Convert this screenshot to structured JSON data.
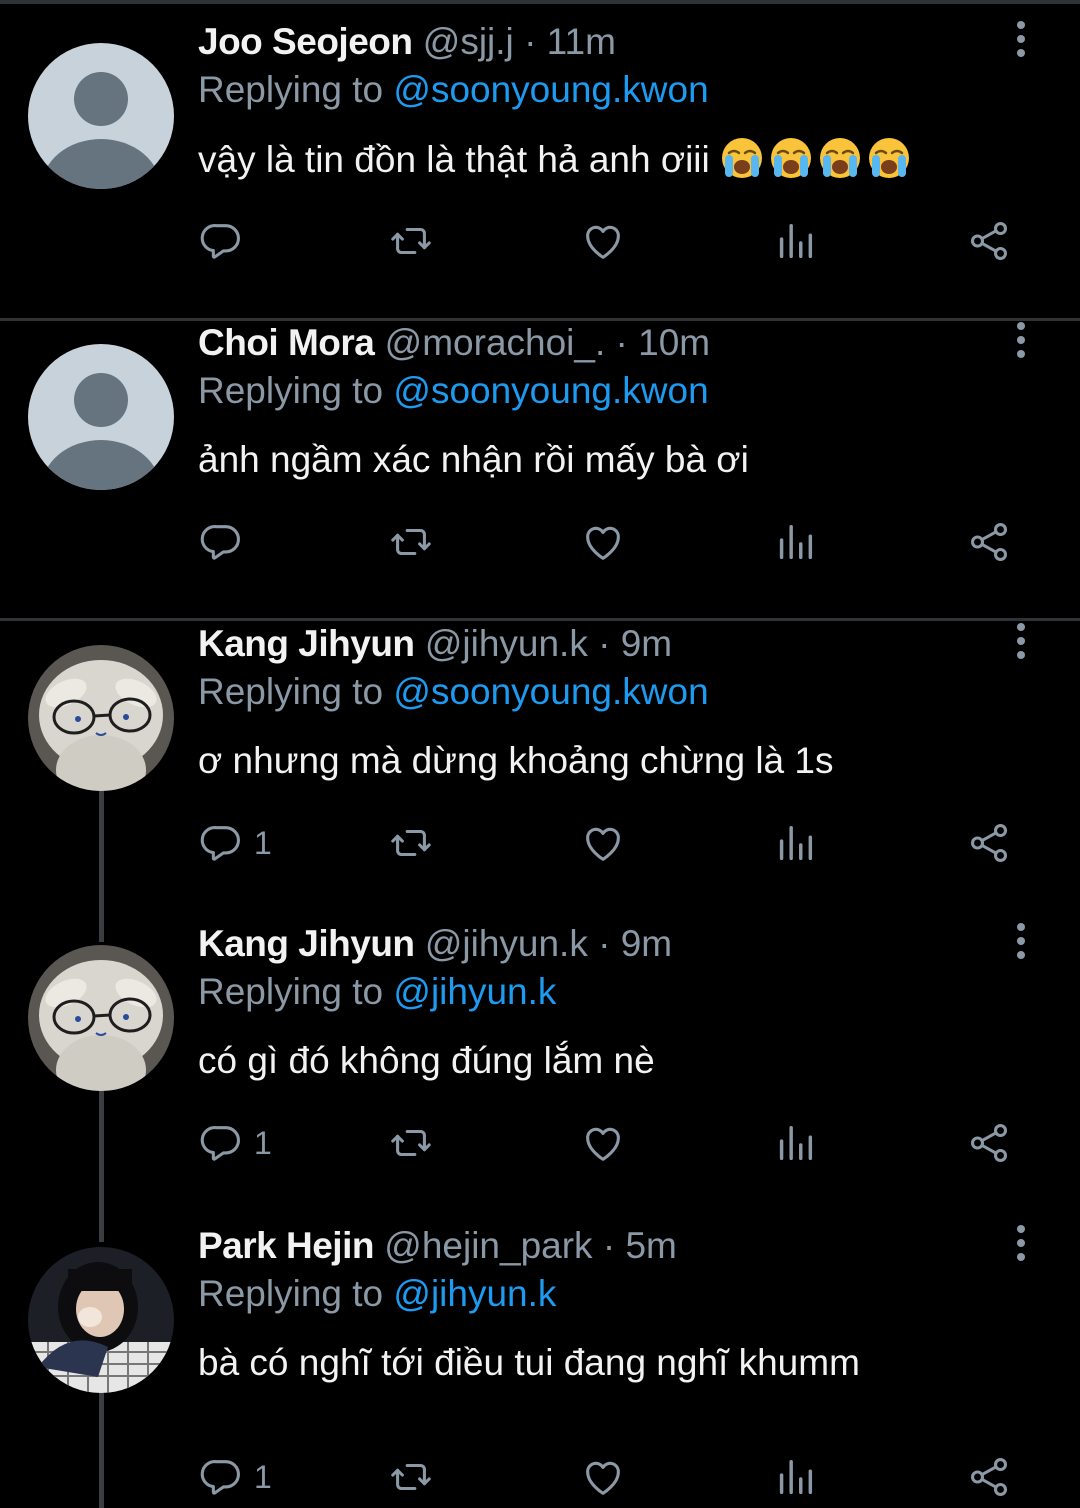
{
  "accent_color": "#1d9bf0",
  "background_color": "#000000",
  "replying_prefix": "Replying to",
  "tweets": [
    {
      "name": "Joo Seojeon",
      "handle": "@sjj.j",
      "time": "11m",
      "replying_to": "@soonyoung.kwon",
      "text": "vậy là tin đồn là thật hả anh ơiii",
      "emojis": [
        "loudly-crying-face",
        "loudly-crying-face",
        "loudly-crying-face",
        "loudly-crying-face"
      ],
      "reply_count": "",
      "avatar": "default-avatar"
    },
    {
      "name": "Choi Mora",
      "handle": "@morachoi_.",
      "time": "10m",
      "replying_to": "@soonyoung.kwon",
      "text": "ảnh ngầm xác nhận rồi mấy bà ơi",
      "emojis": [],
      "reply_count": "",
      "avatar": "default-avatar"
    },
    {
      "name": "Kang Jihyun",
      "handle": "@jihyun.k",
      "time": "9m",
      "replying_to": "@soonyoung.kwon",
      "text": "ơ nhưng mà dừng khoảng chừng là 1s",
      "emojis": [],
      "reply_count": "1",
      "avatar": "plush-toy-avatar"
    },
    {
      "name": "Kang Jihyun",
      "handle": "@jihyun.k",
      "time": "9m",
      "replying_to": "@jihyun.k",
      "text": "có gì đó không đúng lắm nè",
      "emojis": [],
      "reply_count": "1",
      "avatar": "plush-toy-avatar"
    },
    {
      "name": "Park Hejin",
      "handle": "@hejin_park",
      "time": "5m",
      "replying_to": "@jihyun.k",
      "text": "bà có nghĩ tới điều tui đang nghĩ khumm",
      "emojis": [],
      "reply_count": "1",
      "avatar": "girl-photo-avatar"
    }
  ]
}
